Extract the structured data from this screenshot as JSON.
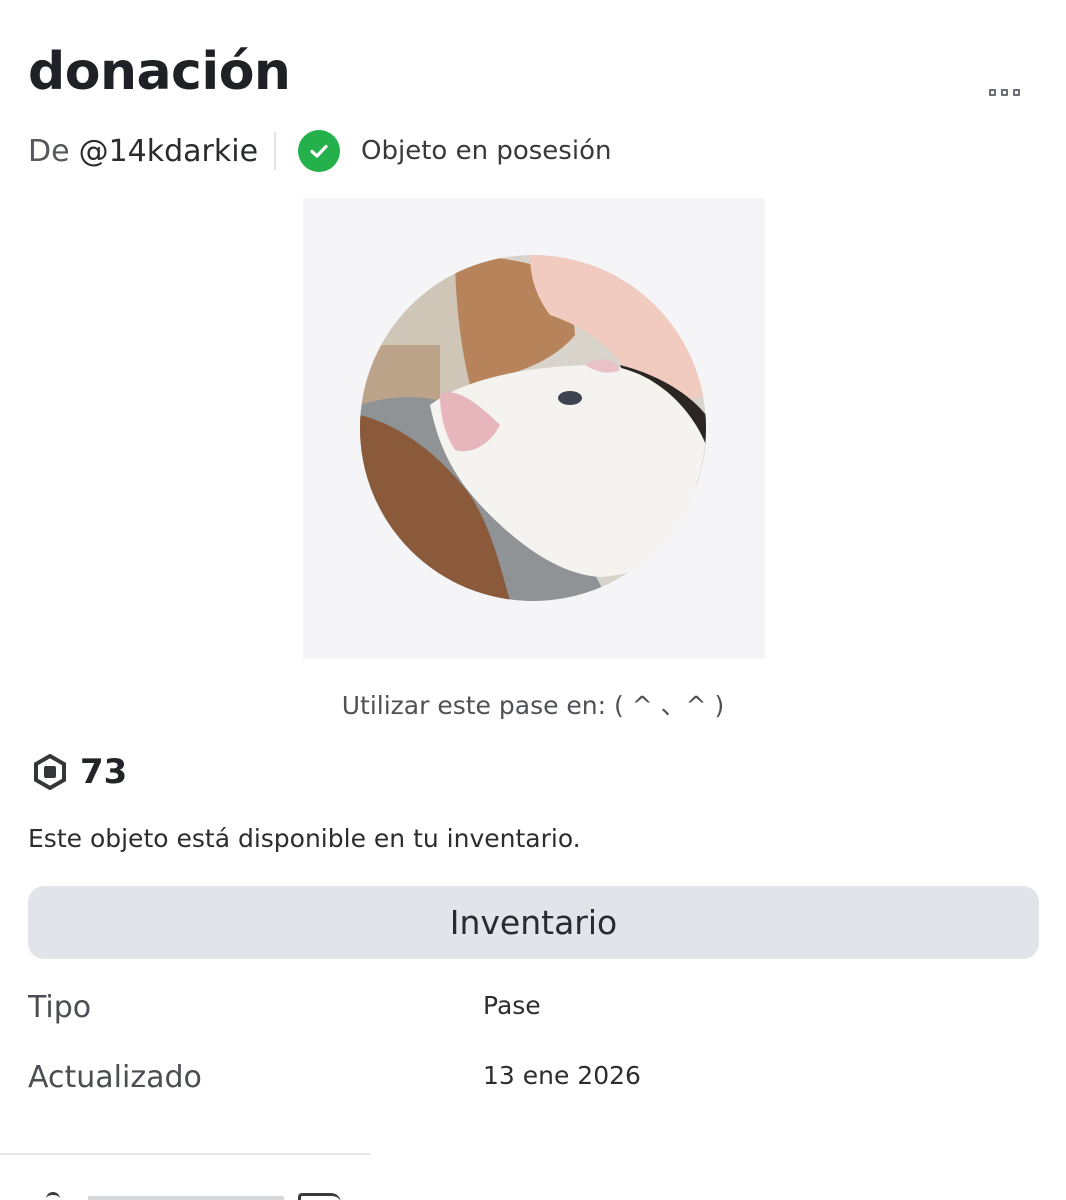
{
  "item": {
    "title": "donación",
    "creator_prefix": "De",
    "creator_handle": "@14kdarkie",
    "owned_status": "Objeto en posesión",
    "use_place": "Utilizar este pase en: ( ^ 、^ )",
    "price": "73",
    "availability_text": "Este objeto está disponible en tu inventario.",
    "inventory_button": "Inventario"
  },
  "details": [
    {
      "label": "Tipo",
      "value": "Pase"
    },
    {
      "label": "Actualizado",
      "value": "13 ene 2026"
    }
  ],
  "icons": {
    "more": "more-options-icon",
    "owned": "check-circle-icon",
    "currency": "robux-icon"
  },
  "colors": {
    "owned_green": "#24b04b",
    "button_bg": "#e3e4e9",
    "thumbnail_bg": "#f5f5f8"
  }
}
